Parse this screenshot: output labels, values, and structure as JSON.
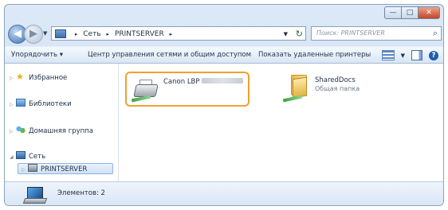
{
  "window": {
    "caption_buttons": {
      "minimize": "—",
      "maximize": "□",
      "close": "✕"
    }
  },
  "address": {
    "back_glyph": "◀",
    "forward_glyph": "▶",
    "dropdown_glyph": "▼",
    "crumbs": [
      "Сеть",
      "PRINTSERVER"
    ],
    "separator": "▸",
    "refresh_glyph": "↻",
    "search_placeholder": "Поиск: PRINTSERVER",
    "search_icon": "⌕"
  },
  "toolbar": {
    "organize": "Упорядочить ▾",
    "network_center": "Центр управления сетями и общим доступом",
    "show_printers": "Показать удаленные принтеры",
    "help_glyph": "?"
  },
  "nav": {
    "favorites": "Избранное",
    "libraries": "Библиотеки",
    "homegroup": "Домашняя группа",
    "network": "Сеть",
    "server": "PRINTSERVER",
    "collapsed_glyph": "▷",
    "expanded_glyph": "◢"
  },
  "files": [
    {
      "name": "Canon LBP",
      "subtitle": "",
      "icon": "printer-icon",
      "selected": true
    },
    {
      "name": "SharedDocs",
      "subtitle": "Общая папка",
      "icon": "shared-folder-icon",
      "selected": false
    }
  ],
  "details": {
    "count_label": "Элементов: 2"
  },
  "colors": {
    "selection_border": "#f0a030",
    "chrome": "#c7d9ee"
  }
}
